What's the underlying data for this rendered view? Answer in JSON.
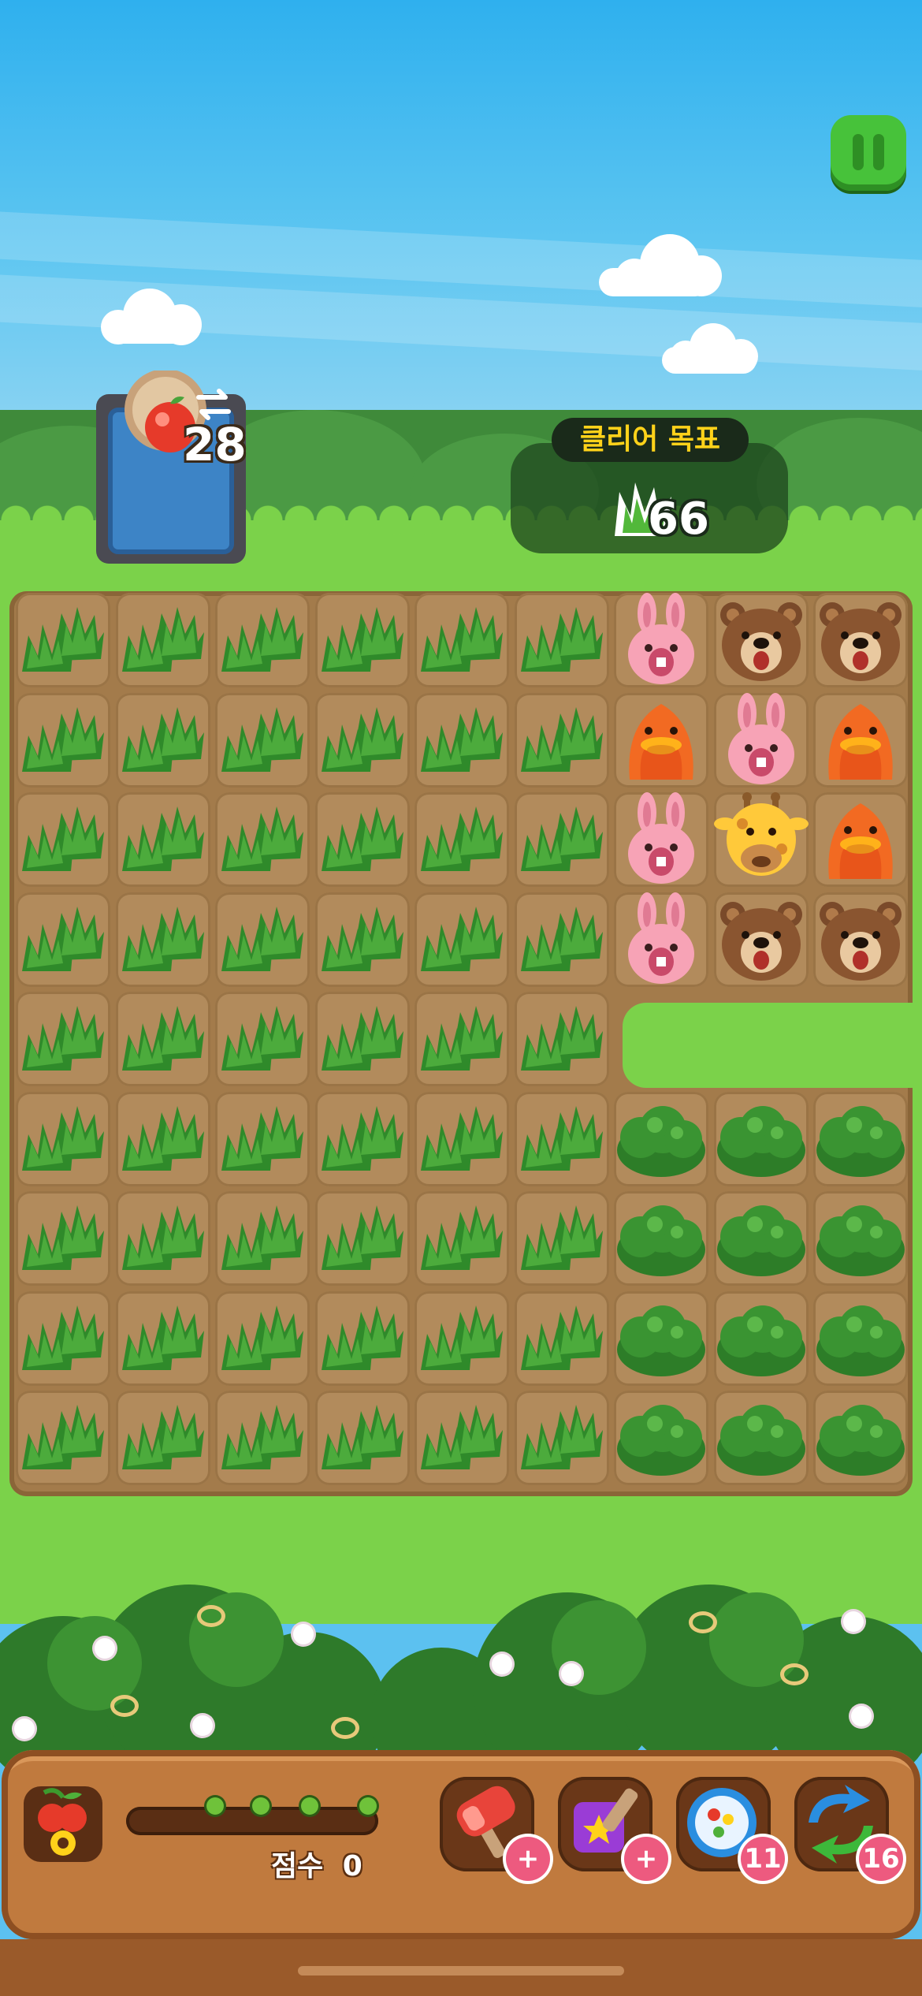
{
  "hud": {
    "moves_left": "28",
    "goal_title": "클리어 목표",
    "goal_icon": "grass-icon",
    "goal_count": "66",
    "pause_icon": "pause-icon"
  },
  "board": {
    "columns": 9,
    "rows": 9,
    "animal_tiles": [
      [
        "rabbit",
        "bear",
        "bear"
      ],
      [
        "duck",
        "rabbit",
        "duck"
      ],
      [
        "rabbit",
        "giraffe",
        "duck"
      ],
      [
        "rabbit",
        "bear",
        "bear"
      ]
    ],
    "grass_columns": 6,
    "bush_rows": 4,
    "bush_columns": 3
  },
  "bottom_panel": {
    "fruit_icon": "cherry-icon",
    "score_label": "점수",
    "score_value": "0",
    "progress_fraction": 0.0,
    "tools": [
      {
        "name": "hammer-icon",
        "badge": "+"
      },
      {
        "name": "magic-cube-icon",
        "badge": "+"
      },
      {
        "name": "bomb-ball-icon",
        "badge": "11"
      },
      {
        "name": "shuffle-icon",
        "badge": "16"
      }
    ]
  },
  "colors": {
    "sky": "#2fb0ee",
    "grass": "#7bd24a",
    "board": "#a37b4b",
    "panel": "#c07a3e",
    "goal_title_text": "#ffd21a",
    "badge": "#ed5a7f"
  }
}
